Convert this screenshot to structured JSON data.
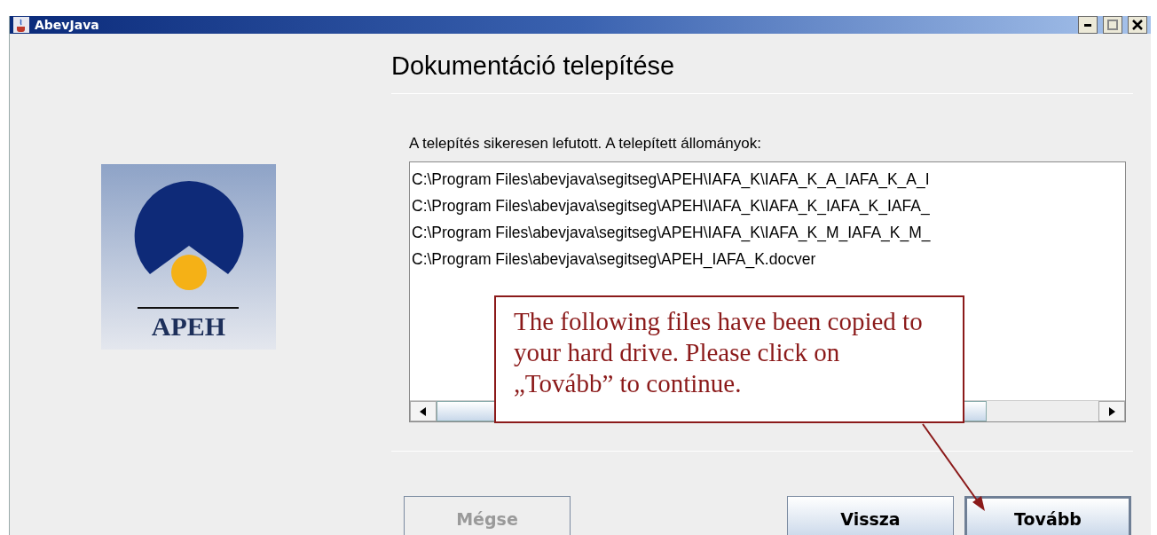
{
  "window": {
    "title": "AbevJava"
  },
  "logo": {
    "text": "APEH"
  },
  "heading": "Dokumentáció telepítése",
  "message": "A telepítés sikeresen lefutott. A telepített állományok:",
  "files": [
    "C:\\Program Files\\abevjava\\segitseg\\APEH\\IAFA_K\\IAFA_K_A_IAFA_K_A_I",
    "C:\\Program Files\\abevjava\\segitseg\\APEH\\IAFA_K\\IAFA_K_IAFA_K_IAFA_",
    "C:\\Program Files\\abevjava\\segitseg\\APEH\\IAFA_K\\IAFA_K_M_IAFA_K_M_",
    "C:\\Program Files\\abevjava\\segitseg\\APEH_IAFA_K.docver"
  ],
  "callout": "The following files have been copied to your hard drive. Please click on „Tovább” to continue.",
  "buttons": [
    {
      "label": "Mégse",
      "disabled": true,
      "default": false
    },
    {
      "label": "Vissza",
      "disabled": false,
      "default": false
    },
    {
      "label": "Tovább",
      "disabled": false,
      "default": true
    }
  ]
}
